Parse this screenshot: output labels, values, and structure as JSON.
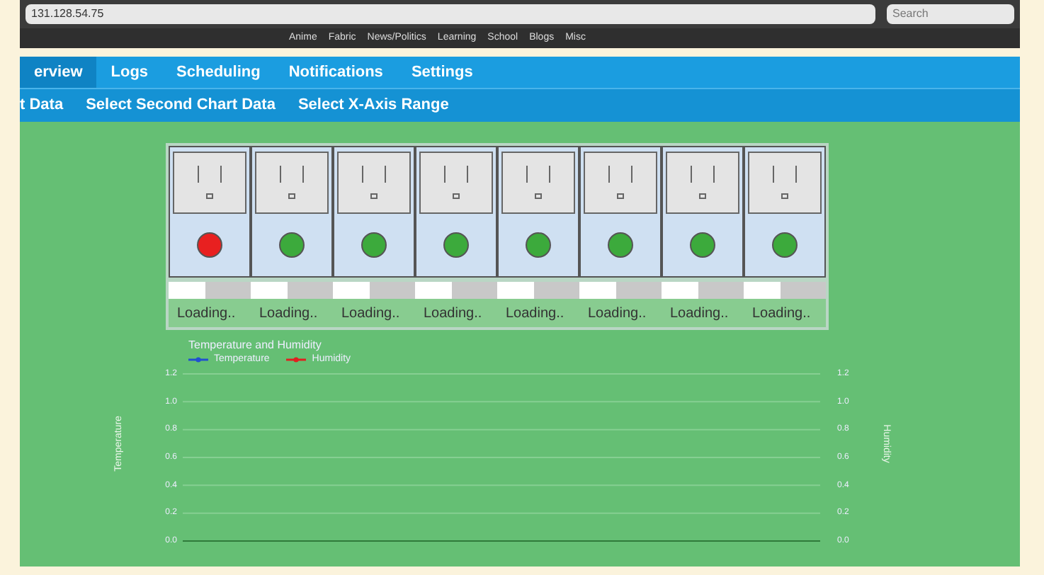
{
  "browser": {
    "address": "131.128.54.75",
    "search_placeholder": "Search",
    "bookmarks": [
      "Anime",
      "Fabric",
      "News/Politics",
      "Learning",
      "School",
      "Blogs",
      "Misc"
    ]
  },
  "nav": [
    {
      "label": "erview",
      "selected": true
    },
    {
      "label": "Logs",
      "selected": false
    },
    {
      "label": "Scheduling",
      "selected": false
    },
    {
      "label": "Notifications",
      "selected": false
    },
    {
      "label": "Settings",
      "selected": false
    }
  ],
  "subnav": [
    "t Data",
    "Select Second Chart Data",
    "Select X-Axis Range"
  ],
  "outlets": [
    {
      "color": "#e82020",
      "level": 0.45,
      "status": "Loading.."
    },
    {
      "color": "#3caa3c",
      "level": 0.45,
      "status": "Loading.."
    },
    {
      "color": "#3caa3c",
      "level": 0.45,
      "status": "Loading.."
    },
    {
      "color": "#3caa3c",
      "level": 0.45,
      "status": "Loading.."
    },
    {
      "color": "#3caa3c",
      "level": 0.45,
      "status": "Loading.."
    },
    {
      "color": "#3caa3c",
      "level": 0.45,
      "status": "Loading.."
    },
    {
      "color": "#3caa3c",
      "level": 0.45,
      "status": "Loading.."
    },
    {
      "color": "#3caa3c",
      "level": 0.45,
      "status": "Loading.."
    }
  ],
  "chart": {
    "chart_data": {
      "type": "line",
      "grid": true,
      "title": "Temperature and Humidity",
      "ylabel": "Temperature",
      "annotations": [
        {
          "text": "Humidity"
        }
      ],
      "series": [
        {
          "name": "Temperature",
          "color": "#2050d0"
        },
        {
          "name": "Humidity",
          "color": "#e02020"
        }
      ],
      "ylim": [
        0,
        1.2
      ],
      "yticks": [
        {
          "value": 0,
          "label": "0.0"
        },
        {
          "value": 0.2,
          "label": "0.2"
        },
        {
          "value": 0.4,
          "label": "0.4"
        },
        {
          "value": 0.6,
          "label": "0.6"
        },
        {
          "value": 0.8,
          "label": "0.8"
        },
        {
          "value": 1,
          "label": "1.0"
        },
        {
          "value": 1.2,
          "label": "1.2"
        }
      ]
    }
  }
}
